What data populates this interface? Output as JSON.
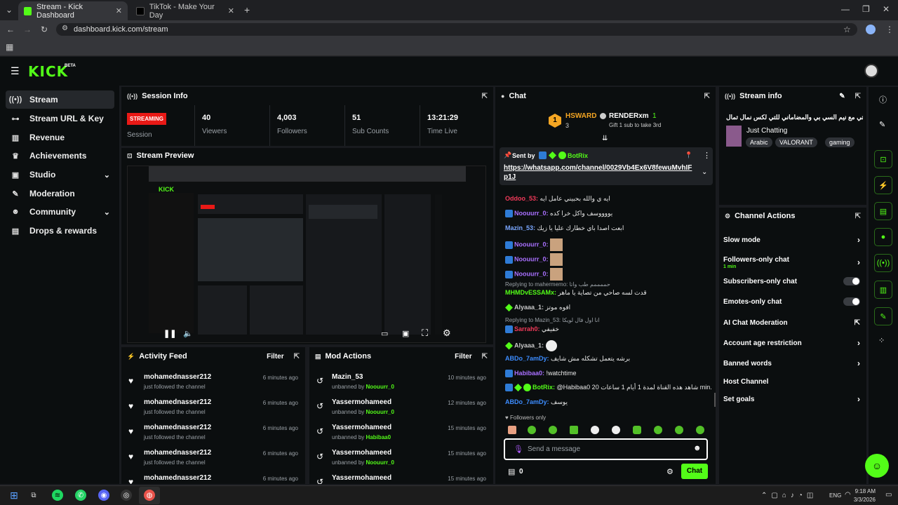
{
  "browser": {
    "tabs": [
      {
        "title": "Stream - Kick Dashboard",
        "active": true
      },
      {
        "title": "TikTok - Make Your Day",
        "active": false
      }
    ],
    "url": "dashboard.kick.com/stream"
  },
  "app": {
    "logo": "KICK",
    "beta": "BETA"
  },
  "sidebar": {
    "items": [
      {
        "label": "Stream",
        "icon": "broadcast-icon",
        "active": true
      },
      {
        "label": "Stream URL & Key",
        "icon": "key-icon"
      },
      {
        "label": "Revenue",
        "icon": "revenue-icon"
      },
      {
        "label": "Achievements",
        "icon": "trophy-icon"
      },
      {
        "label": "Studio",
        "icon": "studio-icon",
        "expand": true
      },
      {
        "label": "Moderation",
        "icon": "wrench-icon"
      },
      {
        "label": "Community",
        "icon": "people-icon",
        "expand": true
      },
      {
        "label": "Drops & rewards",
        "icon": "gift-icon"
      }
    ]
  },
  "session": {
    "title": "Session Info",
    "status": "STREAMING",
    "session_label": "Session",
    "viewers": "40",
    "viewers_label": "Viewers",
    "followers": "4,003",
    "followers_label": "Followers",
    "subs": "51",
    "subs_label": "Sub Counts",
    "time": "13:21:29",
    "time_label": "Time Live"
  },
  "preview": {
    "title": "Stream Preview"
  },
  "activity": {
    "title": "Activity Feed",
    "filter": "Filter",
    "rows": [
      {
        "name": "mohamednasser212",
        "action": "just followed the channel",
        "time": "6 minutes ago"
      },
      {
        "name": "mohamednasser212",
        "action": "just followed the channel",
        "time": "6 minutes ago"
      },
      {
        "name": "mohamednasser212",
        "action": "just followed the channel",
        "time": "6 minutes ago"
      },
      {
        "name": "mohamednasser212",
        "action": "just followed the channel",
        "time": "6 minutes ago"
      },
      {
        "name": "mohamednasser212",
        "action": "",
        "time": "6 minutes ago"
      }
    ]
  },
  "mod": {
    "title": "Mod Actions",
    "filter": "Filter",
    "rows": [
      {
        "name": "Mazin_53",
        "action": "unbanned by",
        "by": "Noouurr_0",
        "time": "10 minutes ago"
      },
      {
        "name": "Yassermohameed",
        "action": "unbanned by",
        "by": "Noouurr_0",
        "time": "12 minutes ago"
      },
      {
        "name": "Yassermohameed",
        "action": "unbanned by",
        "by": "Habibaa0",
        "time": "15 minutes ago"
      },
      {
        "name": "Yassermohameed",
        "action": "unbanned by",
        "by": "Noouurr_0",
        "time": "15 minutes ago"
      },
      {
        "name": "Yassermohameed",
        "action": "",
        "by": "",
        "time": "15 minutes ago"
      }
    ]
  },
  "chat": {
    "title": "Chat",
    "top": {
      "rank": "1",
      "name1": "HSWARD",
      "count1": "3",
      "name2": "RENDERxm",
      "count2": "1",
      "gift_text": "Gift 1 sub to take 3rd"
    },
    "pinned": {
      "sent_by": "Sent by",
      "user": "BotRix",
      "link": "https://whatsapp.com/channel/0029Vb4Ex6V8fewuMvhIFp1J"
    },
    "messages": [
      {
        "user": "Oddoo_53:",
        "text": "ايه ي والله بحبيني عامل ايه",
        "color": "#f23a5a"
      },
      {
        "user": "Noouurr_0:",
        "text": "يووووسف واكل خرا كده",
        "color": "#a970ff"
      },
      {
        "user": "Mazin_53:",
        "text": "ابعت اصدا باي خطارك عليا يا زيك",
        "color": "#7aa7ff"
      },
      {
        "user": "Noouurr_0:",
        "text": "",
        "color": "#a970ff"
      },
      {
        "user": "Noouurr_0:",
        "text": "",
        "color": "#a970ff"
      },
      {
        "user": "Noouurr_0:",
        "text": "",
        "color": "#a970ff"
      },
      {
        "reply": "Replying to mahermemo: حممممم طب واتا"
      },
      {
        "user": "MHMDvESSAMx:",
        "text": "قدت لسه صاحي من تصاية يا ماهر",
        "color": "#53fc18"
      },
      {
        "user": "Alyaaa_1:",
        "text": "افوه موتز",
        "color": "#c8c8c8"
      },
      {
        "reply": "Replying to Mazin_53: انا اول فال لويكا"
      },
      {
        "user": "Sarrah0:",
        "text": "خفيفي",
        "color": "#f23a5a"
      },
      {
        "user": "Alyaaa_1:",
        "text": "",
        "color": "#c8c8c8"
      },
      {
        "user": "ABDo_7amDy:",
        "text": "برشه يتعمل تشكله مش شايف",
        "color": "#3c8cff"
      },
      {
        "user": "Habibaa0:",
        "text": "!watchtime",
        "color": "#a970ff"
      },
      {
        "user": "BotRix:",
        "text": "@Habibaa0 20 شاهد هذه القناة لمدة 1 أيام 1 ساعات min.",
        "color": "#53fc18"
      },
      {
        "user": "ABDo_7amDy:",
        "text": "يوسف",
        "color": "#3c8cff"
      }
    ],
    "followers_only": "Followers only",
    "placeholder": "Send a message",
    "points": "0",
    "send": "Chat"
  },
  "streaminfo": {
    "title": "Stream info",
    "stream_title": "خناقتي مع نيم السي بي والمضاماني للتي لكس نمال تمال",
    "category": "Just Chatting",
    "tags": [
      "Arabic",
      "VALORANT",
      "gaming"
    ]
  },
  "actions": {
    "title": "Channel Actions",
    "items": [
      {
        "label": "Slow mode",
        "type": "arrow"
      },
      {
        "label": "Followers-only chat",
        "sub": "1 min",
        "type": "arrow"
      },
      {
        "label": "Subscribers-only chat",
        "type": "toggle"
      },
      {
        "label": "Emotes-only chat",
        "type": "toggle"
      },
      {
        "label": "AI Chat Moderation",
        "type": "external"
      },
      {
        "label": "Account age restriction",
        "type": "arrow"
      },
      {
        "label": "Banned words",
        "type": "arrow"
      },
      {
        "label": "Host Channel",
        "type": "none"
      },
      {
        "label": "Set goals",
        "type": "arrow"
      }
    ]
  },
  "taskbar": {
    "lang": "ENG",
    "time": "9:18 AM",
    "date": "3/3/2026"
  },
  "colors": {
    "accent": "#53fc18",
    "bg": "#191b1f",
    "panel": "#0b0e0f",
    "streaming": "#e91916"
  }
}
